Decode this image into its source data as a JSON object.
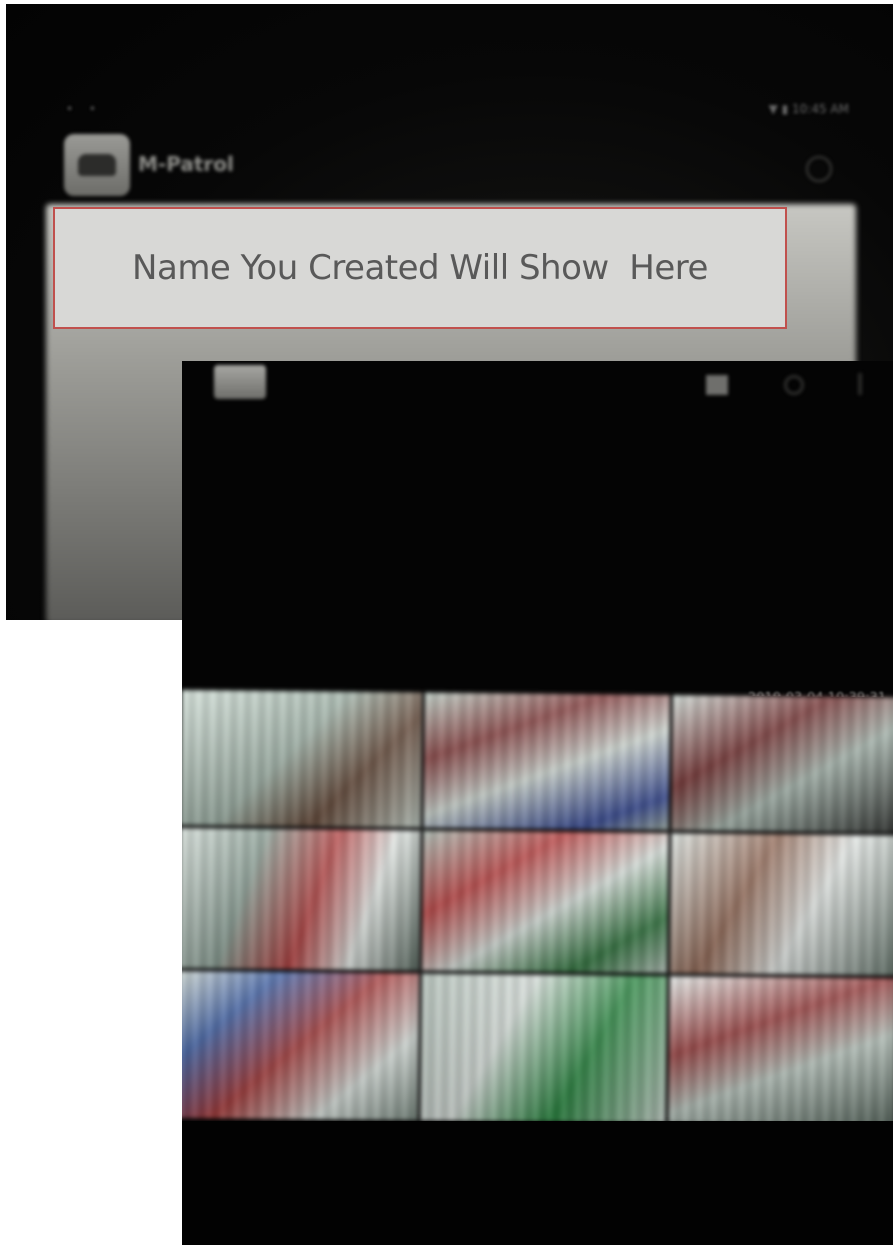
{
  "callout": {
    "text": "Name You Created Will Show  Here"
  },
  "back_screen": {
    "status_bar": {
      "left_icons": "• •",
      "right_text": "▼ ▮ 10:45 AM"
    },
    "app": {
      "name": "M-Patrol"
    }
  },
  "front_screen": {
    "timestamp": "2019-03-04 10:39:31",
    "camera_count": 9
  },
  "colors": {
    "callout_background": "#d8d8d6",
    "callout_border": "#c0504d",
    "callout_text": "#595959",
    "screen_background": "#040404"
  }
}
